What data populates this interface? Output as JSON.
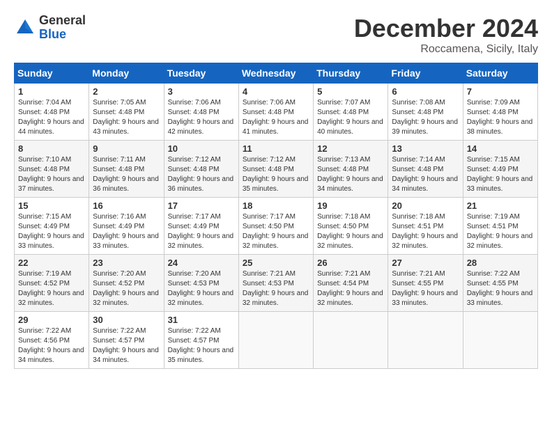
{
  "logo": {
    "general": "General",
    "blue": "Blue"
  },
  "title": "December 2024",
  "location": "Roccamena, Sicily, Italy",
  "headers": [
    "Sunday",
    "Monday",
    "Tuesday",
    "Wednesday",
    "Thursday",
    "Friday",
    "Saturday"
  ],
  "weeks": [
    [
      {
        "day": "1",
        "sunrise": "7:04 AM",
        "sunset": "4:48 PM",
        "daylight": "9 hours and 44 minutes."
      },
      {
        "day": "2",
        "sunrise": "7:05 AM",
        "sunset": "4:48 PM",
        "daylight": "9 hours and 43 minutes."
      },
      {
        "day": "3",
        "sunrise": "7:06 AM",
        "sunset": "4:48 PM",
        "daylight": "9 hours and 42 minutes."
      },
      {
        "day": "4",
        "sunrise": "7:06 AM",
        "sunset": "4:48 PM",
        "daylight": "9 hours and 41 minutes."
      },
      {
        "day": "5",
        "sunrise": "7:07 AM",
        "sunset": "4:48 PM",
        "daylight": "9 hours and 40 minutes."
      },
      {
        "day": "6",
        "sunrise": "7:08 AM",
        "sunset": "4:48 PM",
        "daylight": "9 hours and 39 minutes."
      },
      {
        "day": "7",
        "sunrise": "7:09 AM",
        "sunset": "4:48 PM",
        "daylight": "9 hours and 38 minutes."
      }
    ],
    [
      {
        "day": "8",
        "sunrise": "7:10 AM",
        "sunset": "4:48 PM",
        "daylight": "9 hours and 37 minutes."
      },
      {
        "day": "9",
        "sunrise": "7:11 AM",
        "sunset": "4:48 PM",
        "daylight": "9 hours and 36 minutes."
      },
      {
        "day": "10",
        "sunrise": "7:12 AM",
        "sunset": "4:48 PM",
        "daylight": "9 hours and 36 minutes."
      },
      {
        "day": "11",
        "sunrise": "7:12 AM",
        "sunset": "4:48 PM",
        "daylight": "9 hours and 35 minutes."
      },
      {
        "day": "12",
        "sunrise": "7:13 AM",
        "sunset": "4:48 PM",
        "daylight": "9 hours and 34 minutes."
      },
      {
        "day": "13",
        "sunrise": "7:14 AM",
        "sunset": "4:48 PM",
        "daylight": "9 hours and 34 minutes."
      },
      {
        "day": "14",
        "sunrise": "7:15 AM",
        "sunset": "4:49 PM",
        "daylight": "9 hours and 33 minutes."
      }
    ],
    [
      {
        "day": "15",
        "sunrise": "7:15 AM",
        "sunset": "4:49 PM",
        "daylight": "9 hours and 33 minutes."
      },
      {
        "day": "16",
        "sunrise": "7:16 AM",
        "sunset": "4:49 PM",
        "daylight": "9 hours and 33 minutes."
      },
      {
        "day": "17",
        "sunrise": "7:17 AM",
        "sunset": "4:49 PM",
        "daylight": "9 hours and 32 minutes."
      },
      {
        "day": "18",
        "sunrise": "7:17 AM",
        "sunset": "4:50 PM",
        "daylight": "9 hours and 32 minutes."
      },
      {
        "day": "19",
        "sunrise": "7:18 AM",
        "sunset": "4:50 PM",
        "daylight": "9 hours and 32 minutes."
      },
      {
        "day": "20",
        "sunrise": "7:18 AM",
        "sunset": "4:51 PM",
        "daylight": "9 hours and 32 minutes."
      },
      {
        "day": "21",
        "sunrise": "7:19 AM",
        "sunset": "4:51 PM",
        "daylight": "9 hours and 32 minutes."
      }
    ],
    [
      {
        "day": "22",
        "sunrise": "7:19 AM",
        "sunset": "4:52 PM",
        "daylight": "9 hours and 32 minutes."
      },
      {
        "day": "23",
        "sunrise": "7:20 AM",
        "sunset": "4:52 PM",
        "daylight": "9 hours and 32 minutes."
      },
      {
        "day": "24",
        "sunrise": "7:20 AM",
        "sunset": "4:53 PM",
        "daylight": "9 hours and 32 minutes."
      },
      {
        "day": "25",
        "sunrise": "7:21 AM",
        "sunset": "4:53 PM",
        "daylight": "9 hours and 32 minutes."
      },
      {
        "day": "26",
        "sunrise": "7:21 AM",
        "sunset": "4:54 PM",
        "daylight": "9 hours and 32 minutes."
      },
      {
        "day": "27",
        "sunrise": "7:21 AM",
        "sunset": "4:55 PM",
        "daylight": "9 hours and 33 minutes."
      },
      {
        "day": "28",
        "sunrise": "7:22 AM",
        "sunset": "4:55 PM",
        "daylight": "9 hours and 33 minutes."
      }
    ],
    [
      {
        "day": "29",
        "sunrise": "7:22 AM",
        "sunset": "4:56 PM",
        "daylight": "9 hours and 34 minutes."
      },
      {
        "day": "30",
        "sunrise": "7:22 AM",
        "sunset": "4:57 PM",
        "daylight": "9 hours and 34 minutes."
      },
      {
        "day": "31",
        "sunrise": "7:22 AM",
        "sunset": "4:57 PM",
        "daylight": "9 hours and 35 minutes."
      },
      null,
      null,
      null,
      null
    ]
  ]
}
